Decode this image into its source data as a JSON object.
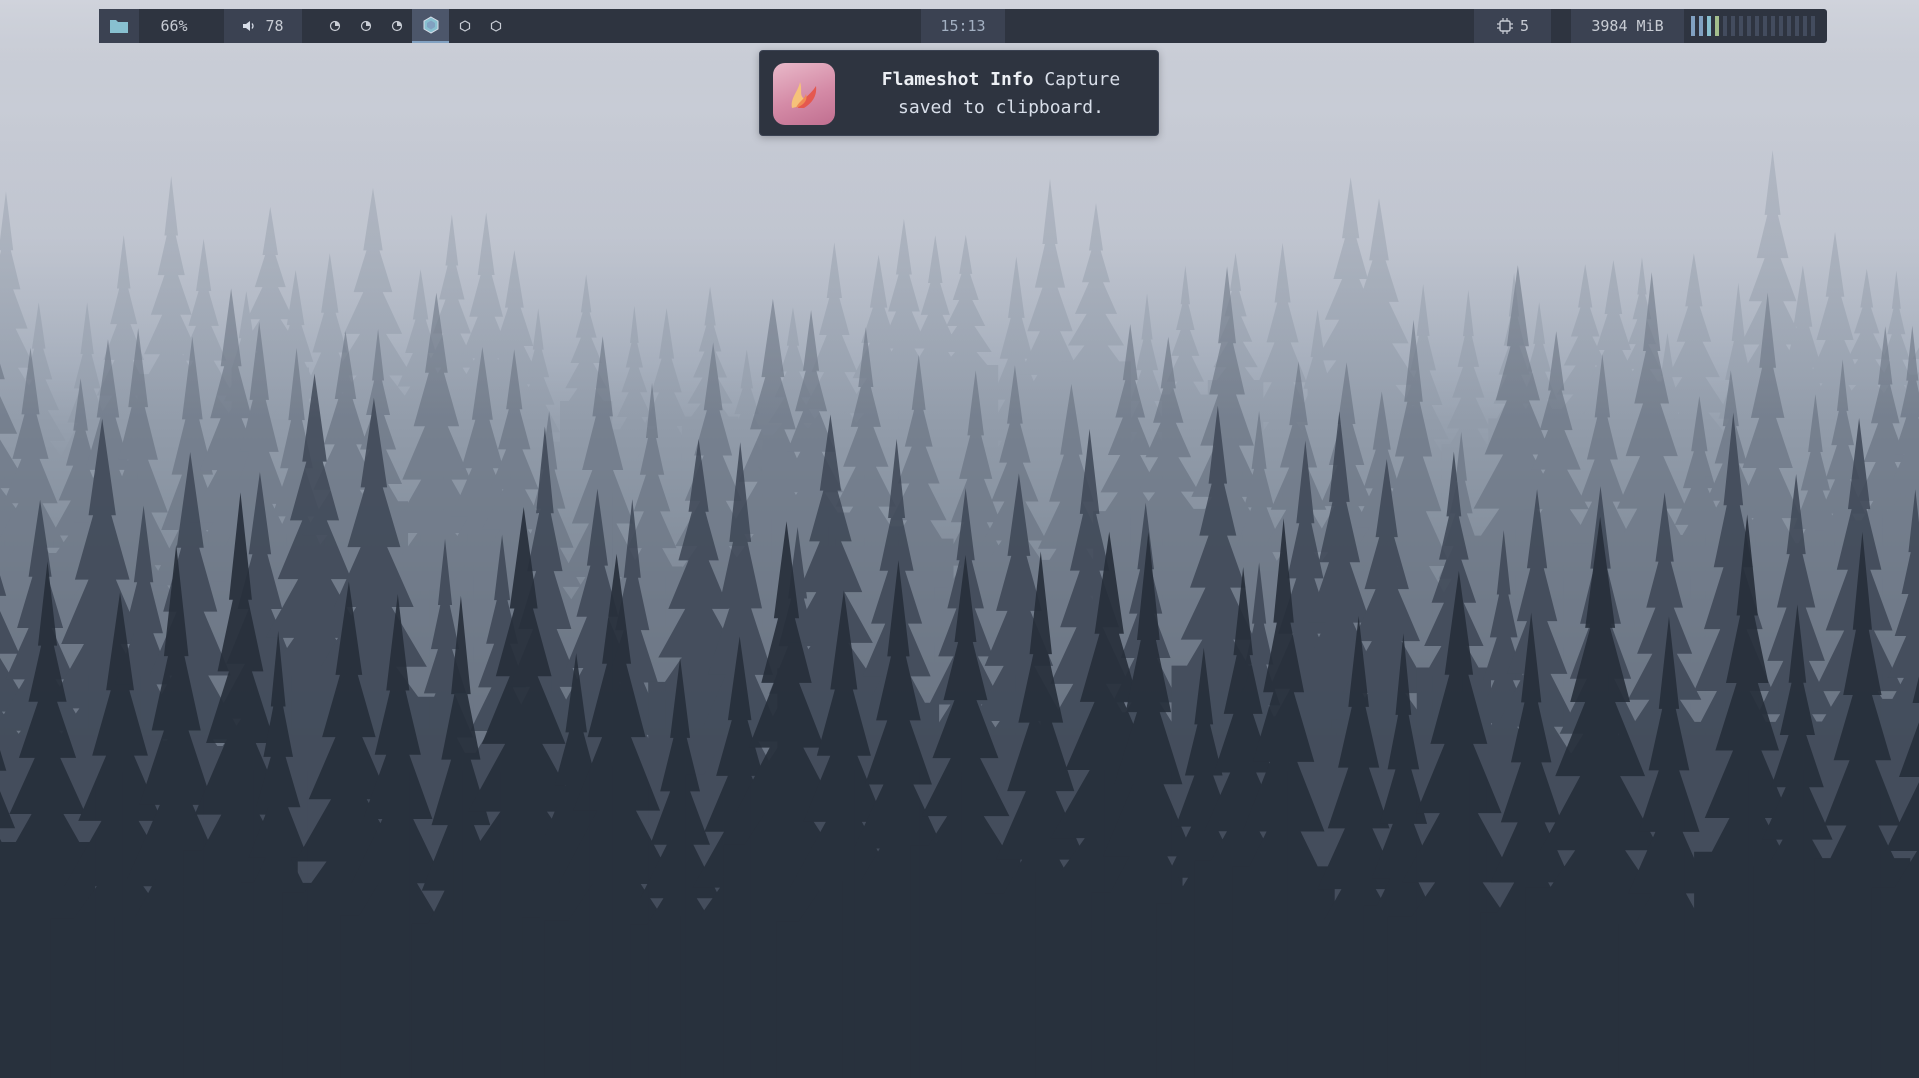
{
  "topbar": {
    "folder_icon": "folder-icon",
    "brightness": "66%",
    "volume": {
      "icon": "speaker-icon",
      "value": "78"
    },
    "workspaces": [
      {
        "icon": "workspace-occupied-icon",
        "active": false
      },
      {
        "icon": "workspace-occupied-icon",
        "active": false
      },
      {
        "icon": "workspace-occupied-icon",
        "active": false
      },
      {
        "icon": "workspace-active-hexagon-icon",
        "active": true
      },
      {
        "icon": "workspace-empty-hexagon-icon",
        "active": false
      },
      {
        "icon": "workspace-empty-hexagon-icon",
        "active": false
      }
    ],
    "clock": "15:13",
    "cpu": {
      "icon": "chip-icon",
      "value": "5"
    },
    "memory": "3984 MiB",
    "cpu_cores": {
      "count": 16,
      "colors": [
        "#81a1c1",
        "#81a1c1",
        "#88c0d0",
        "#a3be8c"
      ],
      "idle_color": "#434c5e"
    },
    "accent": "#81a1c1"
  },
  "notification": {
    "app_icon": "flameshot-icon",
    "title": "Flameshot Info",
    "body": "Capture saved to clipboard."
  }
}
